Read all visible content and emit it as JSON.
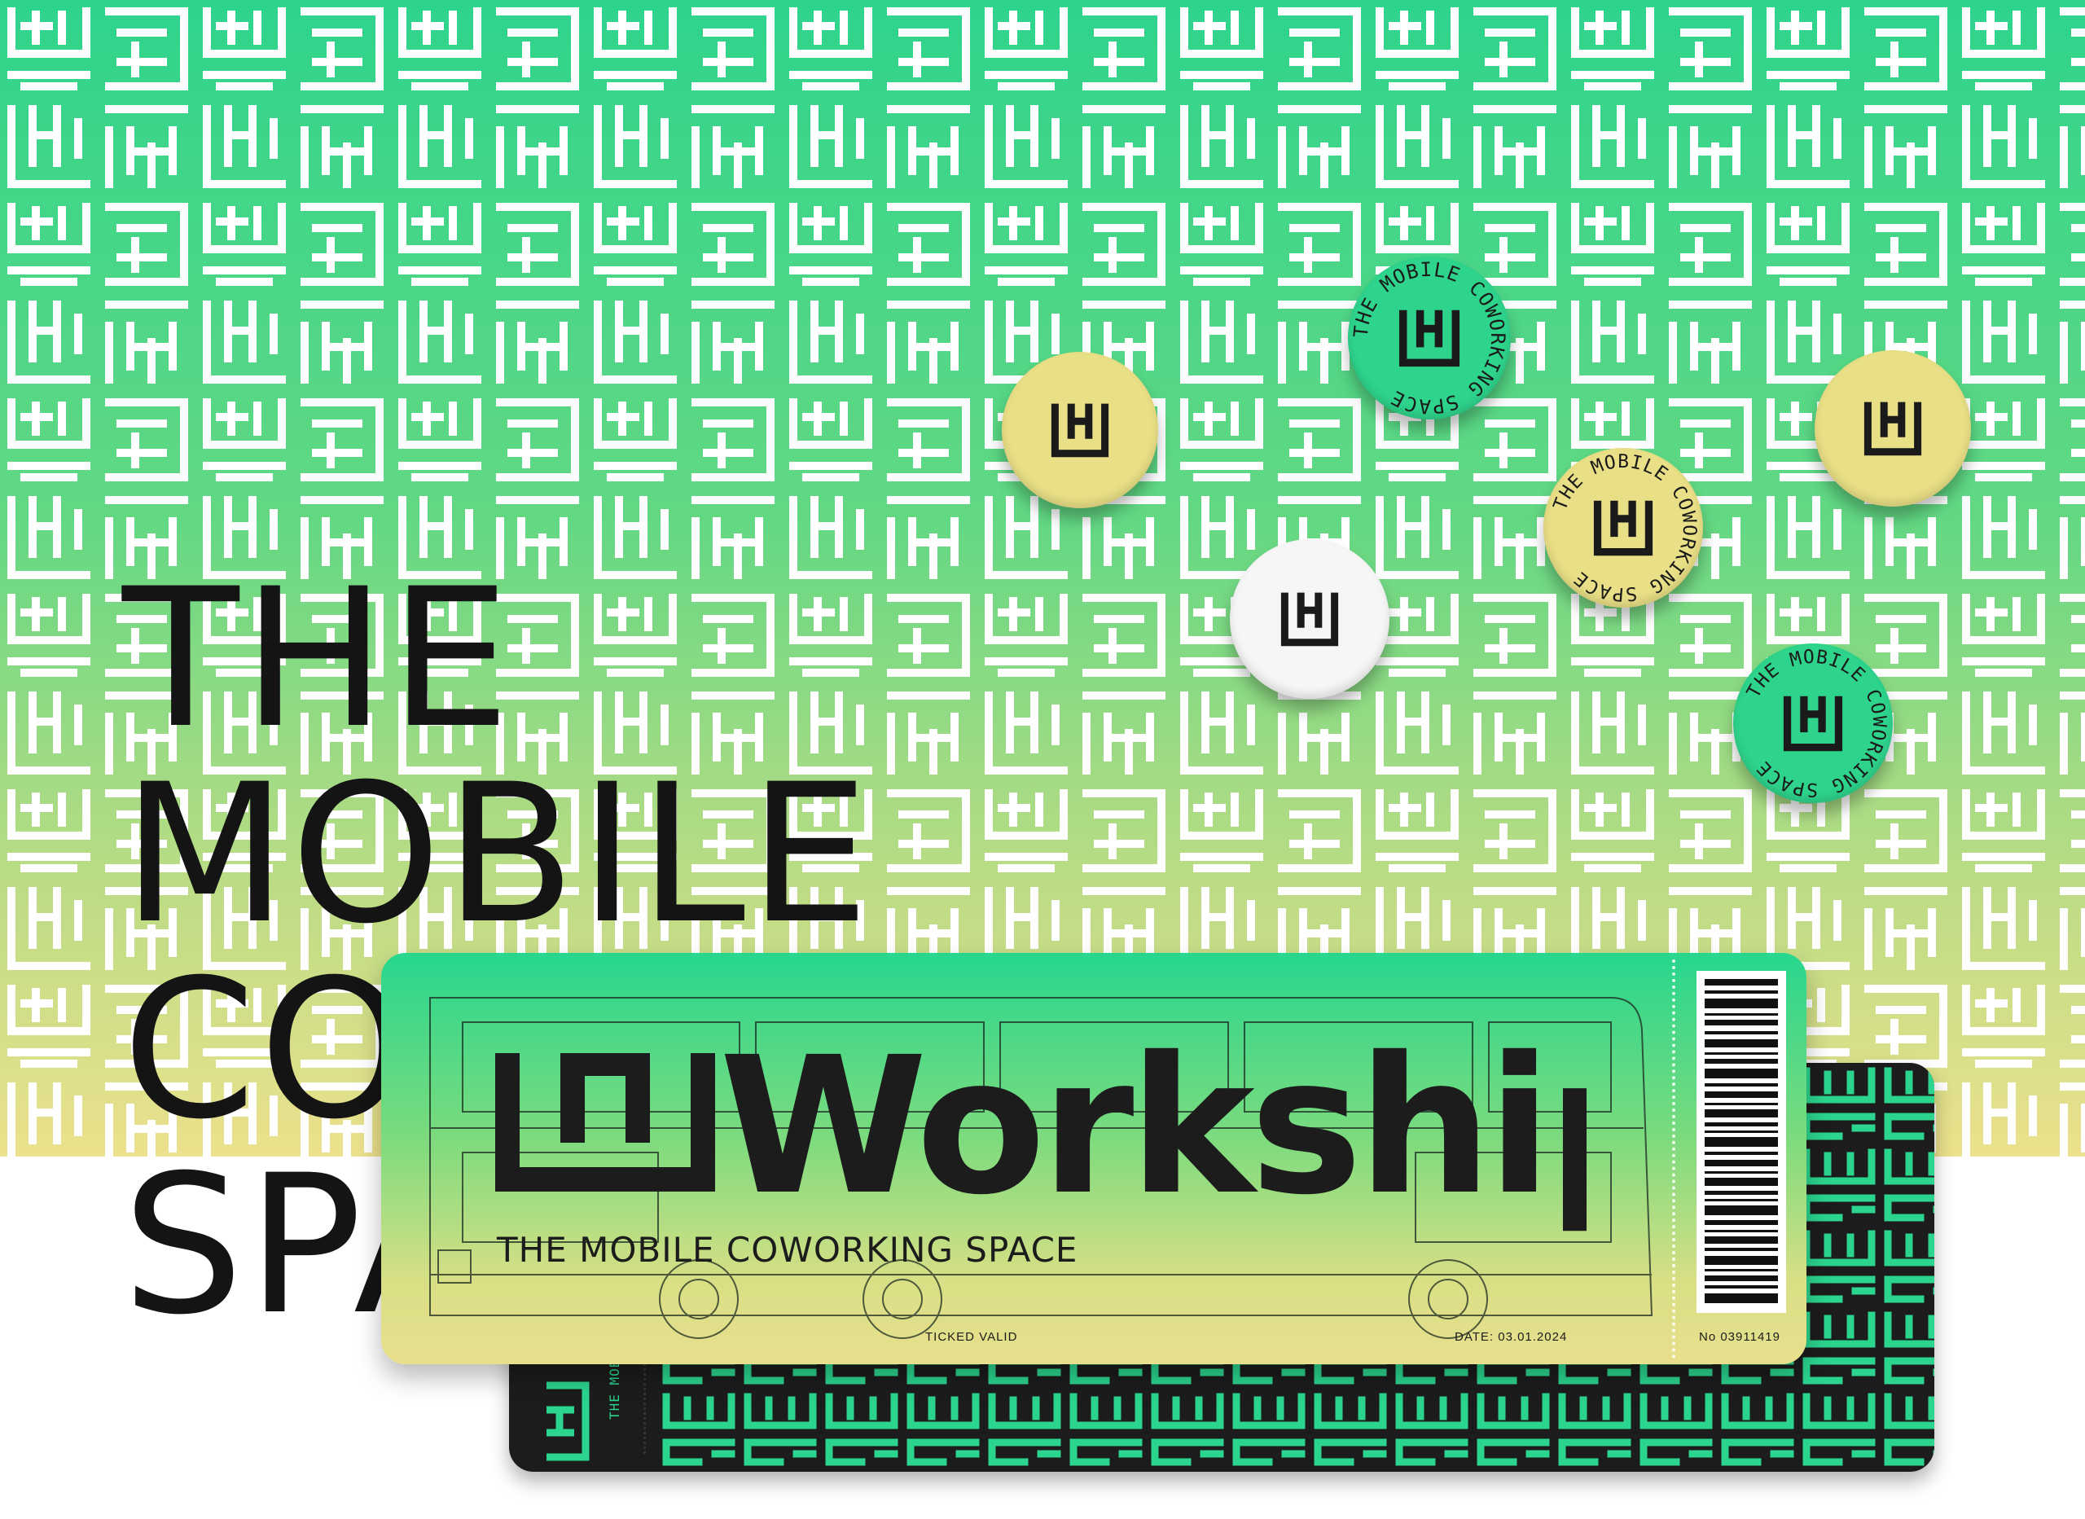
{
  "headline": {
    "lines": [
      "THE",
      "MOBILE",
      "COWORKING",
      "SPACE"
    ]
  },
  "badges": {
    "ring_text": "THE MOBILE COWORKING SPACE",
    "colors": {
      "green": "#2ed48c",
      "gold": "#e9df86",
      "white": "#f6f6f6",
      "ink": "#1a1a1a"
    }
  },
  "ticket": {
    "brand": "Workship",
    "subtitle": "THE MOBILE COWORKING SPACE",
    "validity": "TICKED VALID",
    "date": "DATE: 03.01.2024",
    "number": "No 03911419",
    "back_stub_text": "THE MOBILE",
    "colors": {
      "top": "#27d68e",
      "bottom": "#e8df8d",
      "back": "#1c1c1c",
      "back_pattern": "#2bd58e"
    }
  },
  "background": {
    "colors": {
      "top": "#2ed48c",
      "mid": "#8ad97e",
      "bottom": "#ece18c"
    }
  }
}
